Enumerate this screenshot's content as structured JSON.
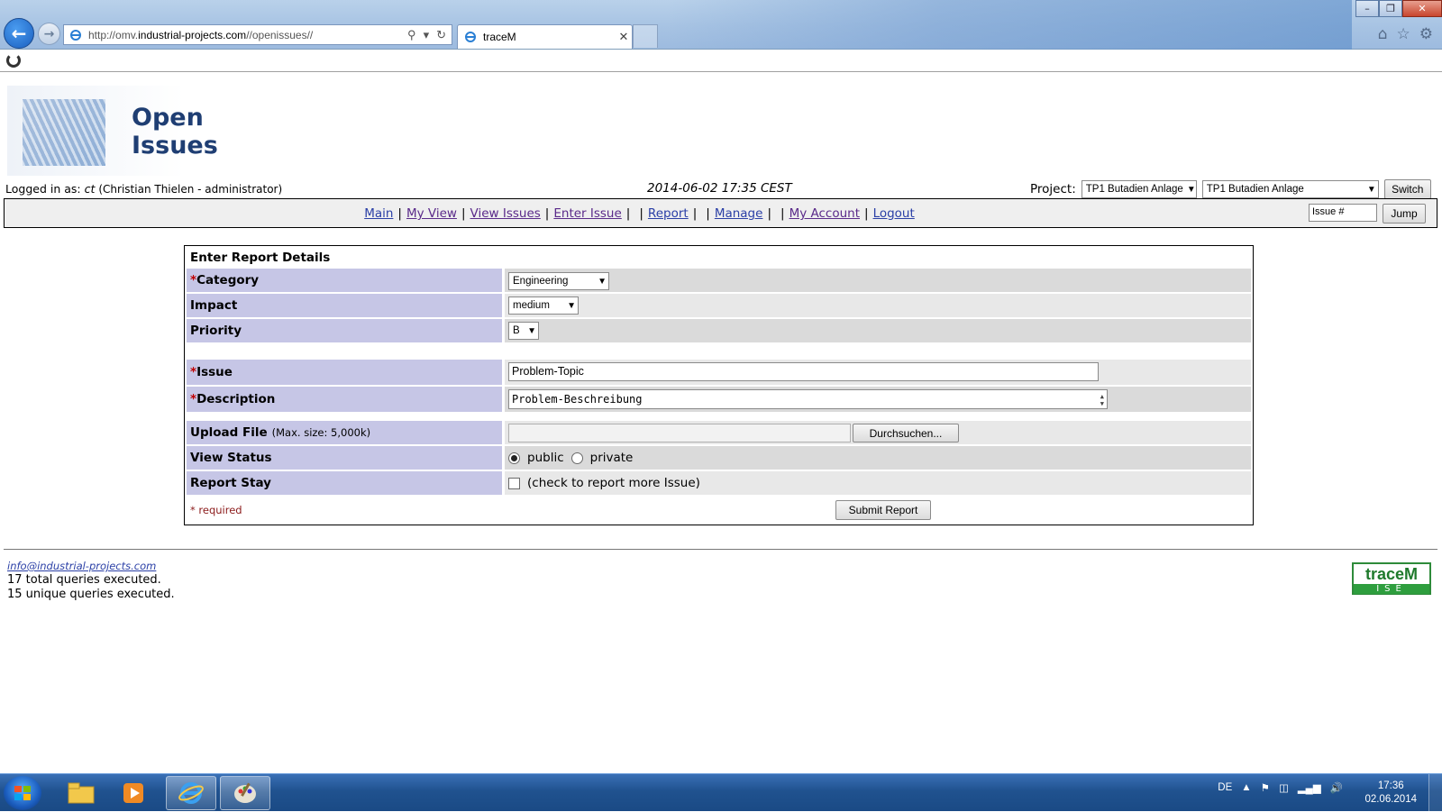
{
  "browser": {
    "url_prefix": "http://omv.",
    "url_domain": "industrial-projects.com",
    "url_path": "//openissues//",
    "tab_title": "traceM"
  },
  "header": {
    "page_title": "Open Issues",
    "logged_in_label": "Logged in as:",
    "username": "ct",
    "user_fullname": "(Christian Thielen - administrator)",
    "datetime": "2014-06-02 17:35 CEST",
    "project_label": "Project:",
    "project_select_1": "TP1 Butadien Anlage",
    "project_select_2": "TP1 Butadien Anlage",
    "switch_label": "Switch"
  },
  "menu": {
    "items": [
      "Main",
      "My View",
      "View Issues",
      "Enter Issue",
      "Report",
      "Manage",
      "My Account",
      "Logout"
    ],
    "issue_placeholder": "Issue #",
    "jump_label": "Jump"
  },
  "form": {
    "title": "Enter Report Details",
    "category_label": "Category",
    "category_value": "Engineering",
    "impact_label": "Impact",
    "impact_value": "medium",
    "priority_label": "Priority",
    "priority_value": "B",
    "issue_label": "Issue",
    "issue_value": "Problem-Topic",
    "description_label": "Description",
    "description_value": "Problem-Beschreibung",
    "upload_label": "Upload File",
    "upload_note": "(Max. size: 5,000k)",
    "browse_label": "Durchsuchen...",
    "view_status_label": "View Status",
    "public_label": "public",
    "private_label": "private",
    "report_stay_label": "Report Stay",
    "report_stay_note": "(check to report more Issue)",
    "required_note": "* required",
    "submit_label": "Submit Report",
    "required_mark": "*"
  },
  "footer": {
    "email": "info@industrial-projects.com",
    "total_queries": "17 total queries executed.",
    "unique_queries": "15 unique queries executed.",
    "logo_top": "traceM",
    "logo_bottom": "ISE"
  },
  "taskbar": {
    "language": "DE",
    "time": "17:36",
    "date": "02.06.2014"
  },
  "colors": {
    "label_bg": "#c6c6e6",
    "link": "#2a3fa6",
    "title": "#1f3e73",
    "logo_green": "#2e9e3e"
  }
}
